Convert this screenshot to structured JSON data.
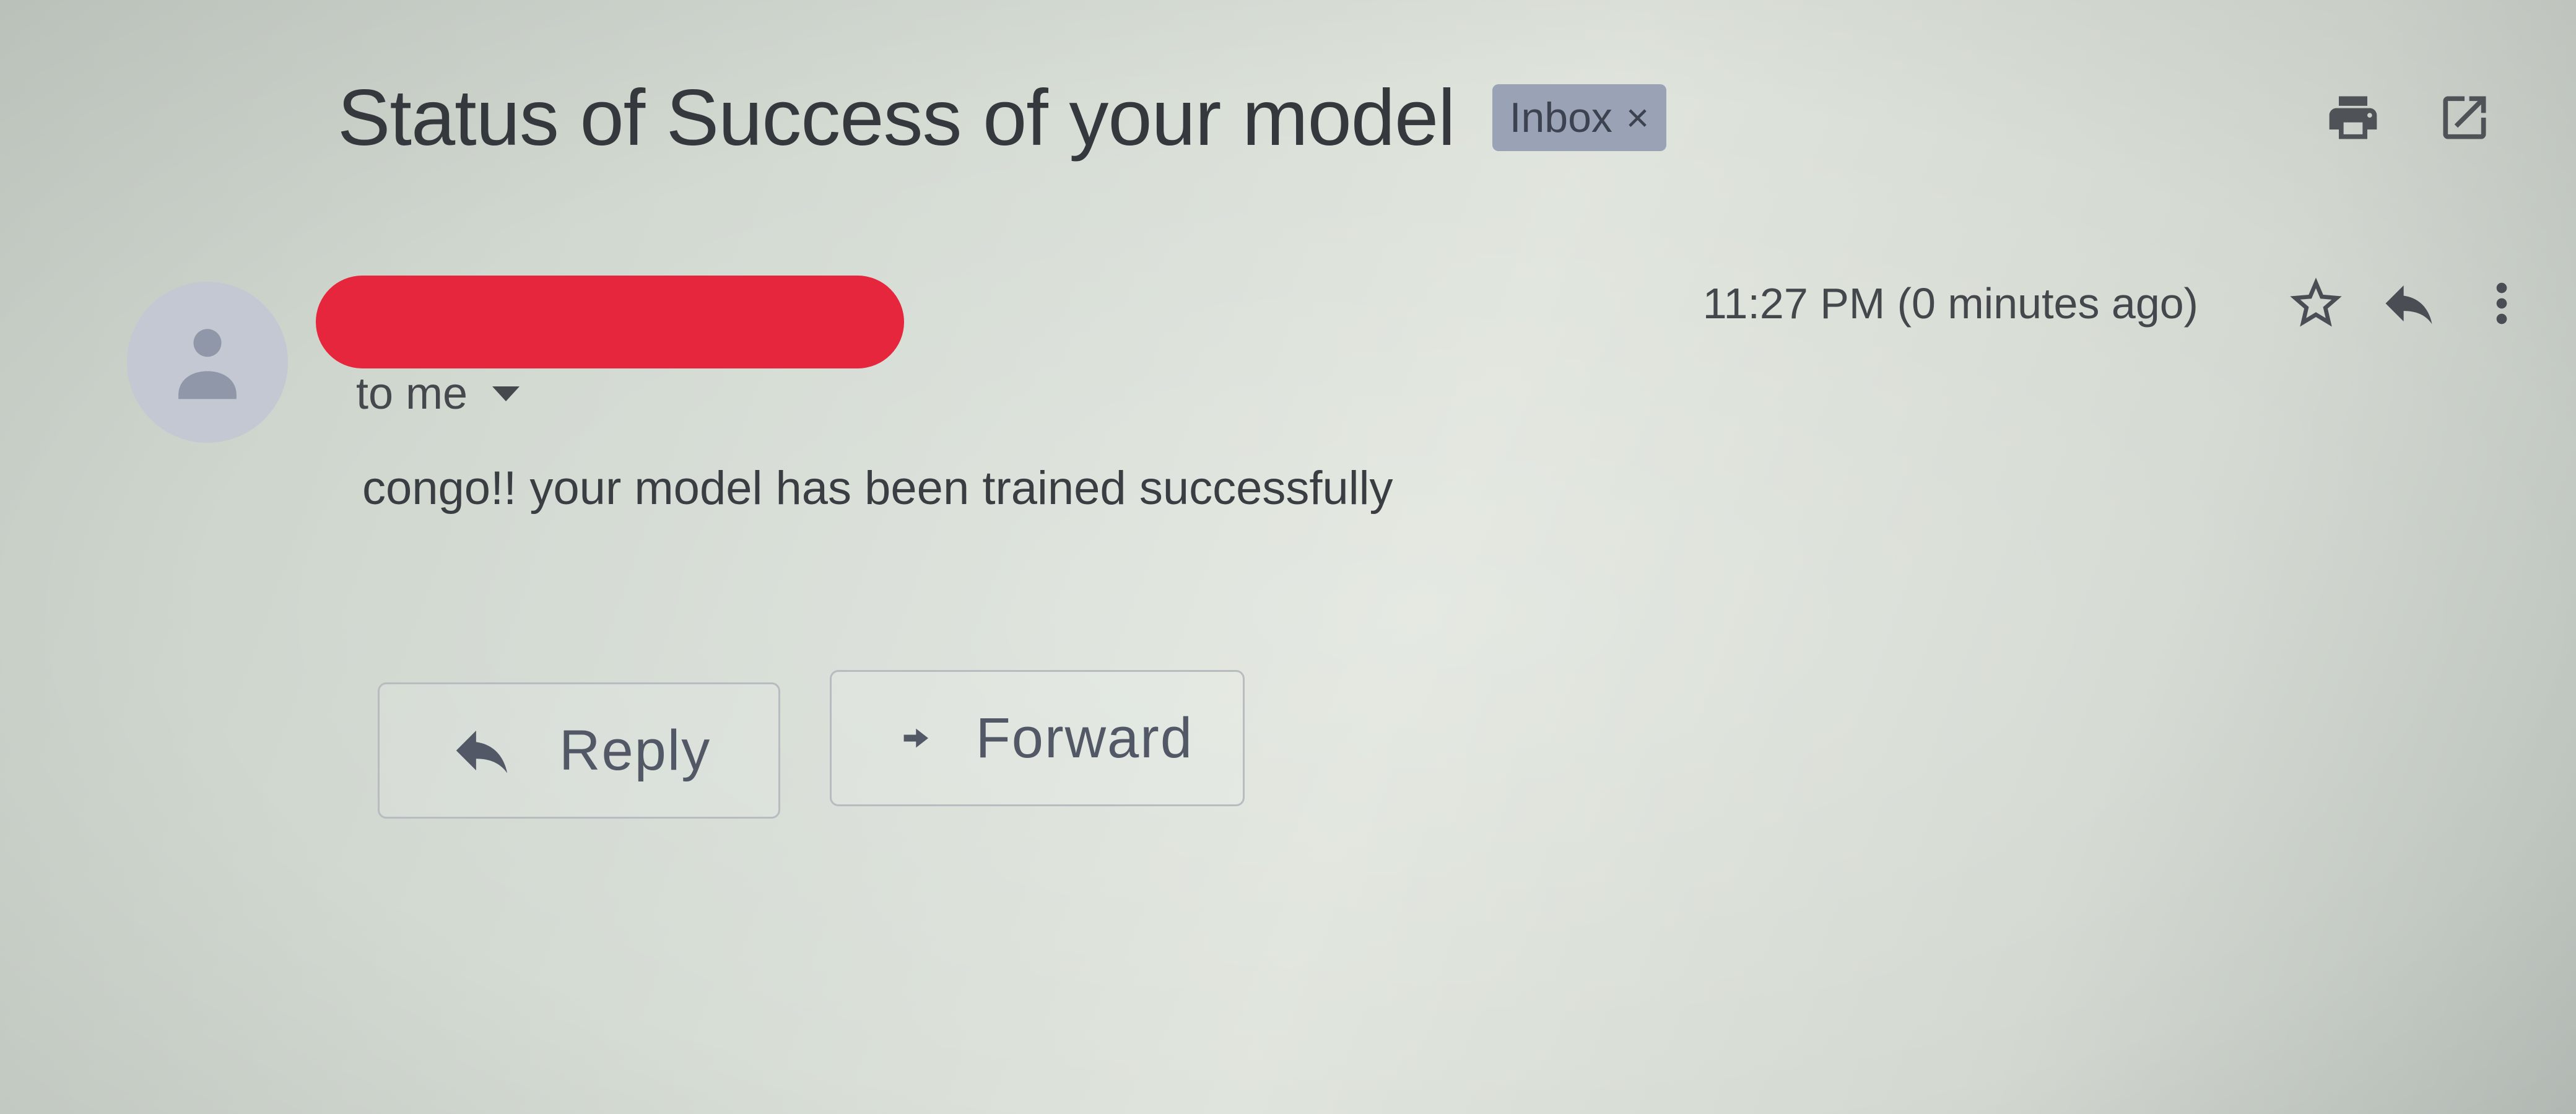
{
  "email": {
    "subject": "Status of Success of your model",
    "label": "Inbox",
    "label_remove": "×",
    "recipient": "to me",
    "timestamp": "11:27 PM (0 minutes ago)",
    "body": "congo!! your model has been trained successfully"
  },
  "header_actions": {
    "print_icon": "print-icon",
    "open_in_new_window_icon": "open-in-new-icon"
  },
  "message_actions": {
    "star_icon": "star-icon",
    "reply_icon": "reply-icon",
    "more_icon": "more-vert-icon"
  },
  "buttons": {
    "reply_label": "Reply",
    "forward_label": "Forward"
  },
  "colors": {
    "redaction": "#e5263d",
    "label_chip": "#9aa3b5"
  }
}
